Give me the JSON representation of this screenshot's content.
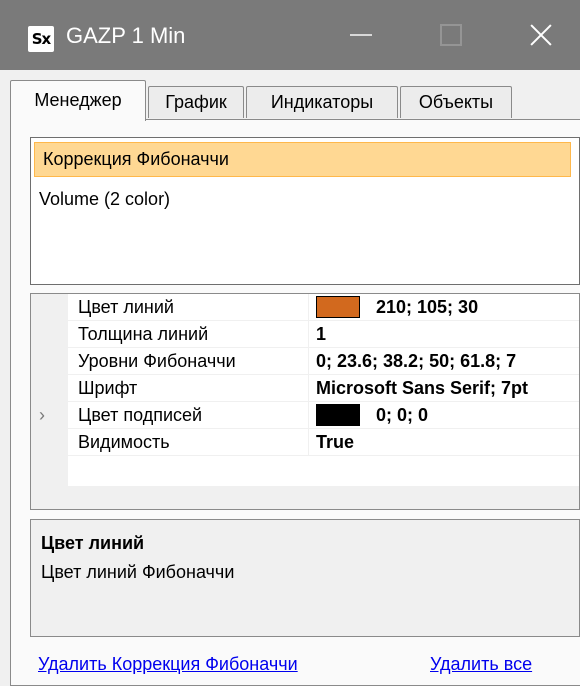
{
  "window": {
    "app_icon_text": "Sx",
    "title": "GAZP 1 Min"
  },
  "tabs": [
    {
      "label": "Менеджер",
      "active": true
    },
    {
      "label": "График",
      "active": false
    },
    {
      "label": "Индикаторы",
      "active": false
    },
    {
      "label": "Объекты",
      "active": false
    }
  ],
  "indicator_list": {
    "items": [
      {
        "label": "Коррекция Фибоначчи",
        "selected": true
      },
      {
        "label": "Volume (2 color)",
        "selected": false
      }
    ]
  },
  "properties": [
    {
      "name": "Цвет линий",
      "value": "210; 105; 30",
      "swatch_color": "#d2691e"
    },
    {
      "name": "Толщина линий",
      "value": "1"
    },
    {
      "name": "Уровни Фибоначчи",
      "value": "0; 23.6; 38.2; 50; 61.8; 7"
    },
    {
      "name": "Шрифт",
      "value": "Microsoft Sans Serif; 7pt",
      "expand_icon": "chevron-right-icon"
    },
    {
      "name": "Цвет подписей",
      "value": "0; 0; 0",
      "swatch_color": "#000000"
    },
    {
      "name": "Видимость",
      "value": "True"
    }
  ],
  "help": {
    "title": "Цвет линий",
    "description": "Цвет линий Фибоначчи"
  },
  "links": {
    "delete_selected": "Удалить Коррекция Фибоначчи",
    "delete_all": "Удалить все"
  },
  "colors": {
    "title_bar": "#7a7a7a",
    "selection_bg": "#ffd893",
    "selection_border": "#ffb84b",
    "link": "#0000ee"
  }
}
